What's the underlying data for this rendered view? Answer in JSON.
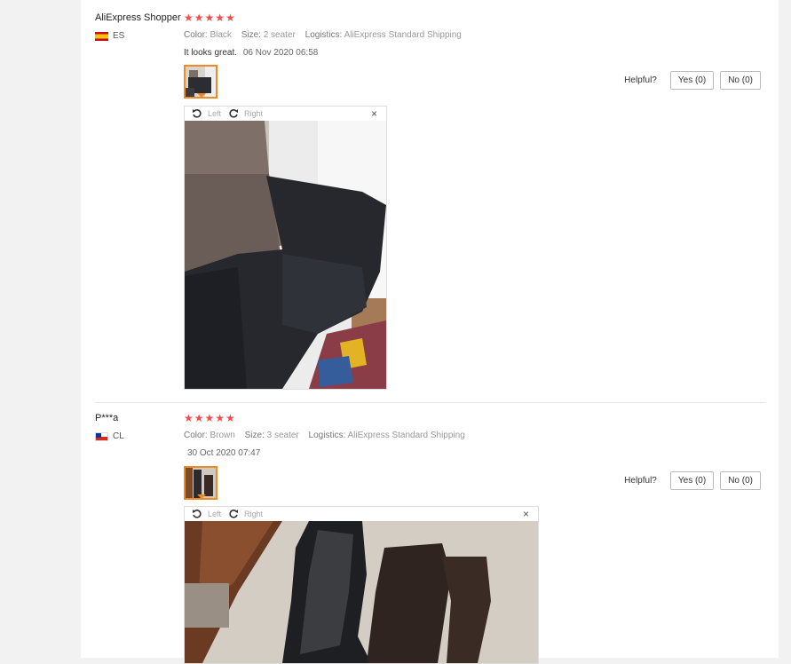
{
  "reviews": [
    {
      "name": "AliExpress Shopper",
      "country": "ES",
      "stars": "★★★★★",
      "color_label": "Color:",
      "color": "Black",
      "size_label": "Size:",
      "size": "2 seater",
      "logistics_label": "Logistics:",
      "logistics": "AliExpress Standard Shipping",
      "text": "It looks great.",
      "date": "06 Nov 2020 06:58",
      "helpful_label": "Helpful?",
      "yes": "Yes (0)",
      "no": "No (0)",
      "rotate_left": "Left",
      "rotate_right": "Right",
      "close": "×"
    },
    {
      "name": "P***a",
      "country": "CL",
      "stars": "★★★★★",
      "color_label": "Color:",
      "color": "Brown",
      "size_label": "Size:",
      "size": "3 seater",
      "logistics_label": "Logistics:",
      "logistics": "AliExpress Standard Shipping",
      "text": "",
      "date": "30 Oct 2020 07:47",
      "helpful_label": "Helpful?",
      "yes": "Yes (0)",
      "no": "No (0)",
      "rotate_left": "Left",
      "rotate_right": "Right",
      "close": "×"
    }
  ],
  "colors": {
    "star": "#f44b4b",
    "thumb_border": "#f08a24"
  }
}
